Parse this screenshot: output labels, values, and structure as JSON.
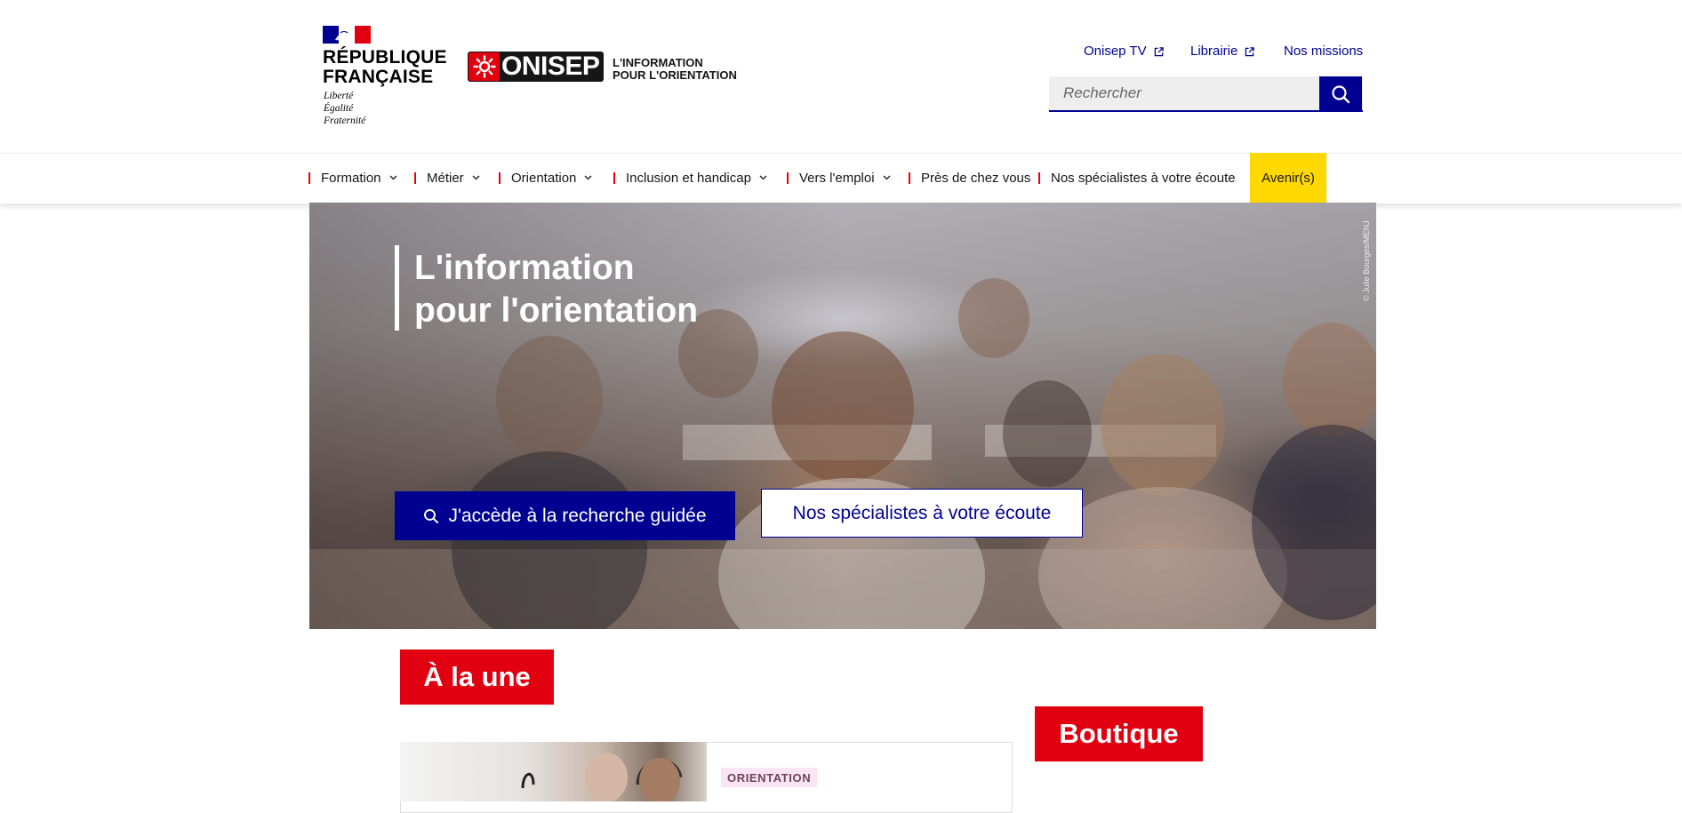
{
  "header": {
    "republique": {
      "line1": "RÉPUBLIQUE",
      "line2": "FRANÇAISE",
      "motto1": "Liberté",
      "motto2": "Égalité",
      "motto3": "Fraternité"
    },
    "brand": {
      "name": "ONISEP",
      "tagline1": "L'INFORMATION",
      "tagline2": "POUR L'ORIENTATION"
    },
    "top_links": [
      {
        "label": "Onisep TV",
        "external": true
      },
      {
        "label": "Librairie",
        "external": true
      },
      {
        "label": "Nos missions",
        "external": false
      }
    ],
    "search": {
      "placeholder": "Rechercher",
      "value": ""
    }
  },
  "nav": {
    "items": [
      {
        "label": "Formation",
        "dropdown": true
      },
      {
        "label": "Métier",
        "dropdown": true
      },
      {
        "label": "Orientation",
        "dropdown": true
      },
      {
        "label": "Inclusion et handicap",
        "dropdown": true
      },
      {
        "label": "Vers l'emploi",
        "dropdown": true
      },
      {
        "label": "Près de chez vous",
        "dropdown": false
      },
      {
        "label": "Nos spécialistes à votre écoute",
        "dropdown": false
      }
    ],
    "highlight": "Avenir(s)"
  },
  "hero": {
    "title_line1": "L'information",
    "title_line2": "pour l'orientation",
    "credit": "© Julie Bourges/MENJ",
    "primary_button": "J'accède à la recherche guidée",
    "secondary_button": "Nos spécialistes à votre écoute"
  },
  "content": {
    "une_title": "À la une",
    "boutique_title": "Boutique",
    "card": {
      "tag": "ORIENTATION"
    }
  },
  "colors": {
    "blue_france": "#000091",
    "red_marianne": "#e1000f",
    "avenirs_yellow": "#ffd800",
    "tag_pink": "#fbe4f4"
  }
}
